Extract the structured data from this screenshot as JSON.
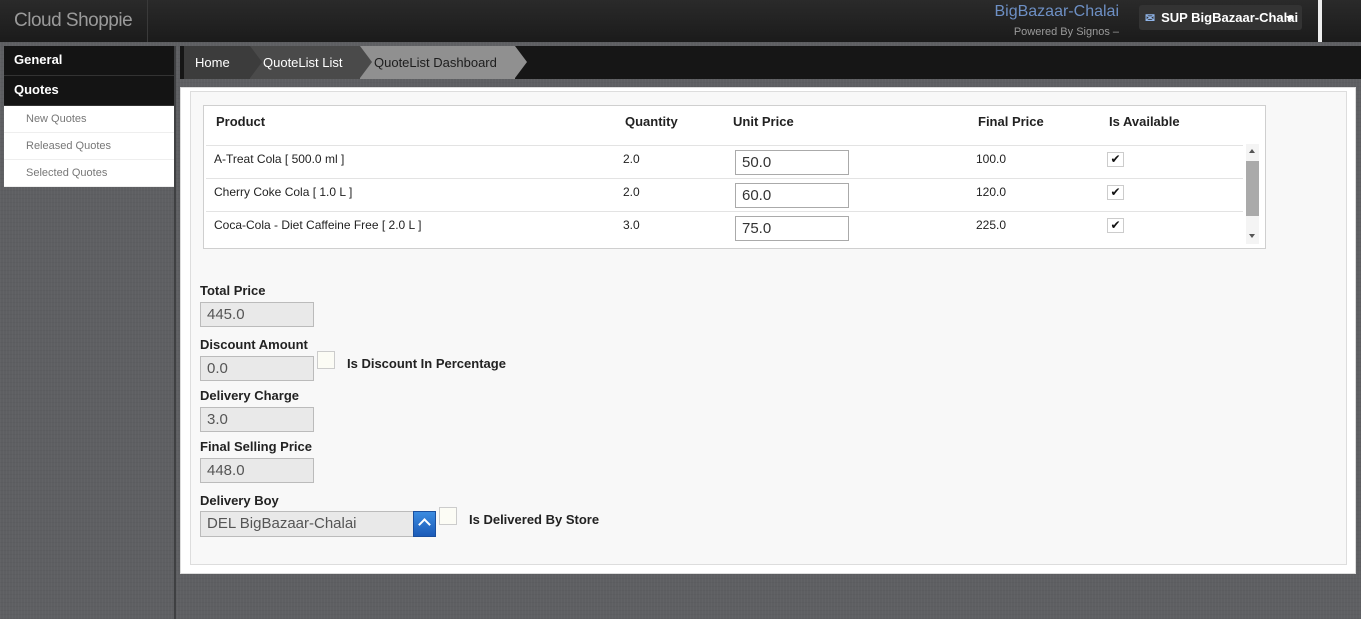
{
  "header": {
    "app_title": "Cloud Shoppie",
    "store_name": "BigBazaar-Chalai",
    "powered_by": "Powered By Signos –",
    "user_label": "SUP BigBazaar-Chalai"
  },
  "sidebar": {
    "sections": [
      {
        "label": "General"
      },
      {
        "label": "Quotes"
      }
    ],
    "items": [
      {
        "label": "New Quotes"
      },
      {
        "label": "Released Quotes"
      },
      {
        "label": "Selected Quotes"
      }
    ]
  },
  "breadcrumb": {
    "items": [
      {
        "label": "Home"
      },
      {
        "label": "QuoteList List"
      },
      {
        "label": "QuoteList Dashboard"
      }
    ]
  },
  "table": {
    "columns": [
      "Product",
      "Quantity",
      "Unit Price",
      "Final Price",
      "Is Available"
    ],
    "rows": [
      {
        "product": "A-Treat Cola [ 500.0 ml ]",
        "quantity": "2.0",
        "unit_price": "50.0",
        "final_price": "100.0",
        "available": "✔"
      },
      {
        "product": "Cherry Coke Cola [ 1.0 L ]",
        "quantity": "2.0",
        "unit_price": "60.0",
        "final_price": "120.0",
        "available": "✔"
      },
      {
        "product": "Coca-Cola - Diet Caffeine Free [ 2.0 L ]",
        "quantity": "3.0",
        "unit_price": "75.0",
        "final_price": "225.0",
        "available": "✔"
      }
    ]
  },
  "form": {
    "total_price_label": "Total Price",
    "total_price": "445.0",
    "discount_label": "Discount Amount",
    "discount": "0.0",
    "discount_pct_label": "Is Discount In Percentage",
    "delivery_charge_label": "Delivery Charge",
    "delivery_charge": "3.0",
    "final_price_label": "Final Selling Price",
    "final_price": "448.0",
    "delivery_boy_label": "Delivery Boy",
    "delivery_boy": "DEL BigBazaar-Chalai",
    "delivered_by_store_label": "Is Delivered By Store"
  }
}
